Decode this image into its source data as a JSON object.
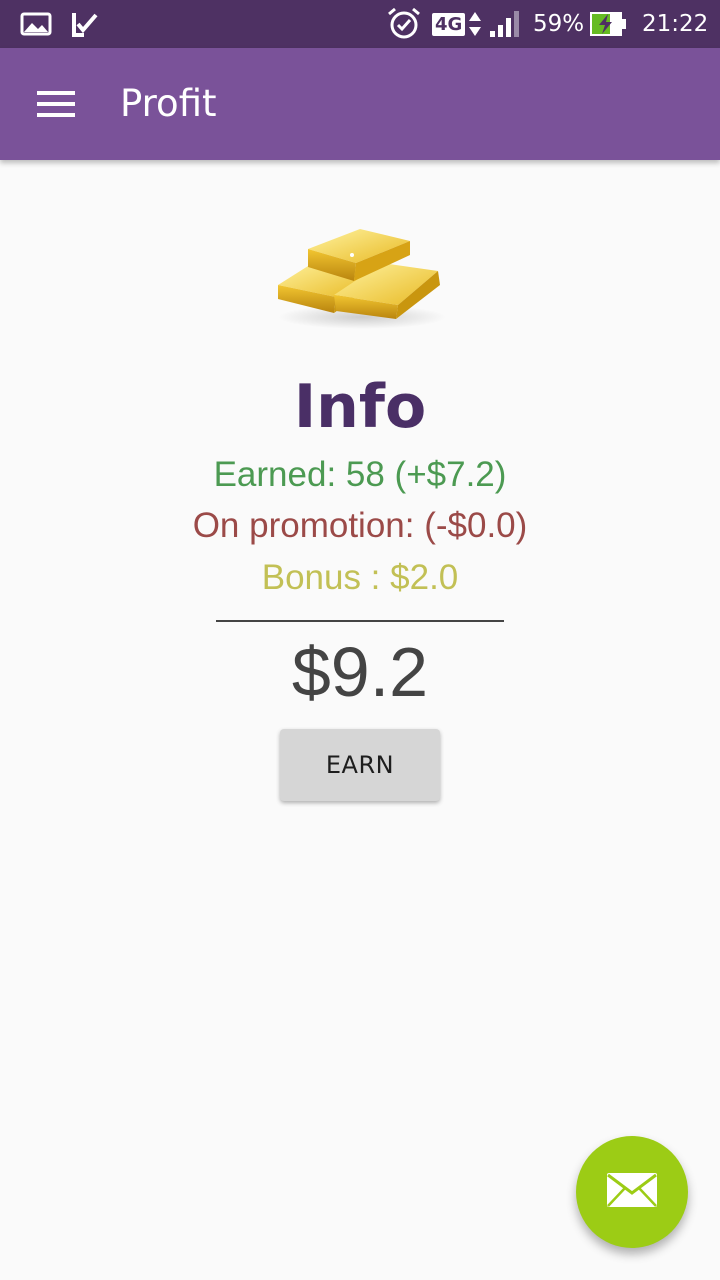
{
  "status_bar": {
    "icons": [
      "gallery-icon",
      "checkmark-notification-icon",
      "alarm-icon",
      "network-4g-icon",
      "signal-icon",
      "battery-charging-icon"
    ],
    "network_label": "4G",
    "battery_percent": "59%",
    "time": "21:22"
  },
  "app_bar": {
    "title": "Profit",
    "menu_icon": "hamburger-menu-icon"
  },
  "main": {
    "image": "gold-bars-icon",
    "heading": "Info",
    "earned": "Earned: 58 (+$7.2)",
    "promotion": "On promotion: (-$0.0)",
    "bonus": "Bonus : $2.0",
    "total": "$9.2",
    "earn_button": "EARN"
  },
  "fab": {
    "icon": "mail-icon"
  },
  "colors": {
    "status_bar": "#4e3163",
    "app_bar": "#7a5299",
    "heading": "#4a2f66",
    "earned": "#4c9a52",
    "promotion": "#9b4a48",
    "bonus": "#c2c055",
    "fab": "#9ccc15"
  }
}
